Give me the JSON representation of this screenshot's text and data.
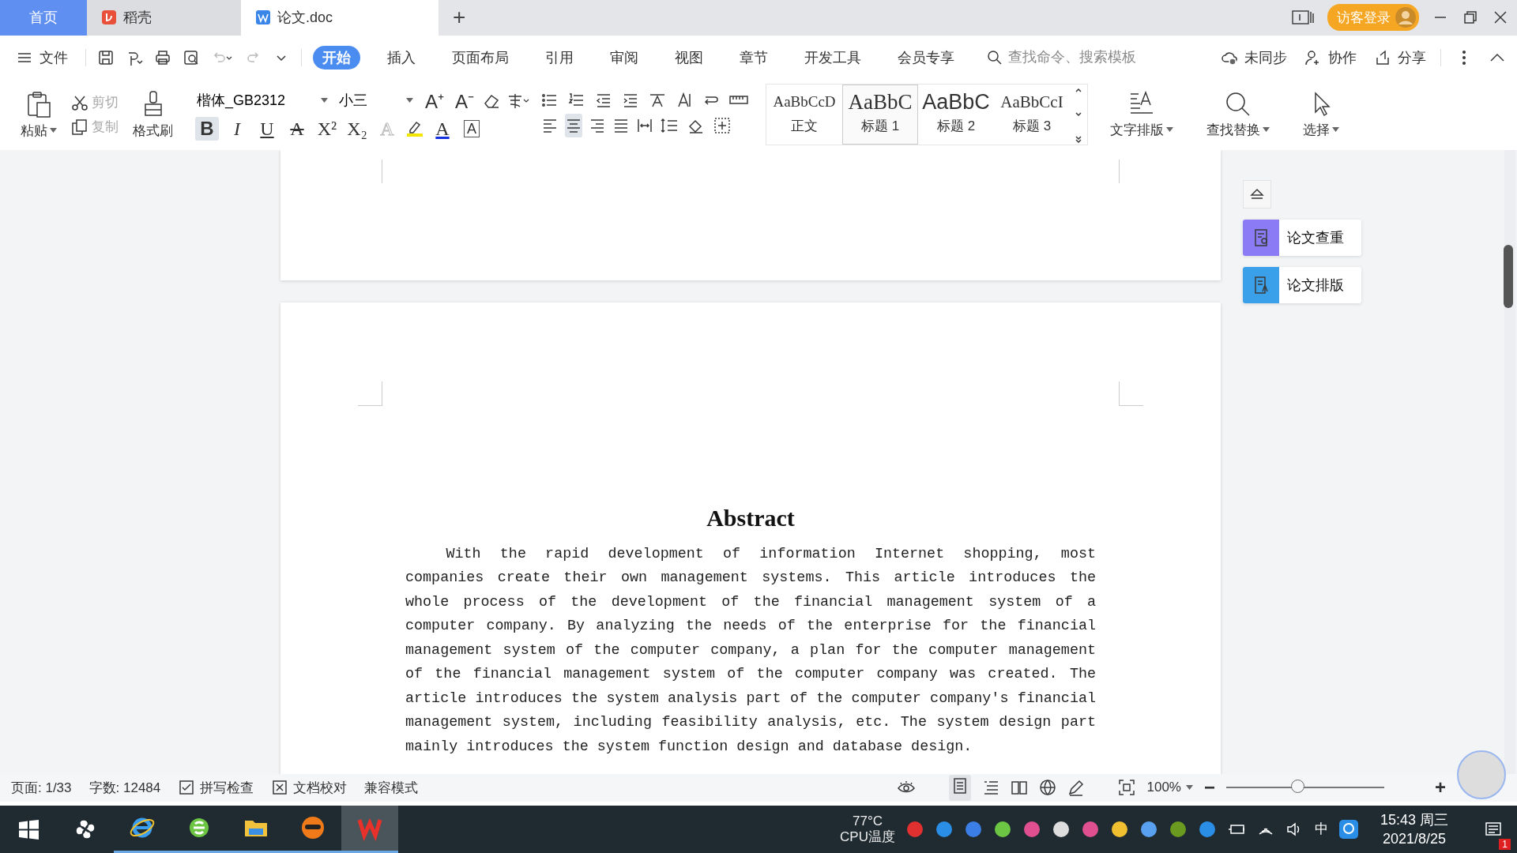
{
  "tabs": [
    {
      "label": "首页",
      "kind": "home",
      "selected": false
    },
    {
      "label": "稻壳",
      "kind": "app",
      "selected": false
    },
    {
      "label": "论文.doc",
      "kind": "doc",
      "selected": true
    }
  ],
  "new_tab": "+",
  "login_button": "访客登录",
  "menu": {
    "file": "文件",
    "tabs": [
      {
        "label": "开始",
        "selected": true
      },
      {
        "label": "插入",
        "selected": false
      },
      {
        "label": "页面布局",
        "selected": false
      },
      {
        "label": "引用",
        "selected": false
      },
      {
        "label": "审阅",
        "selected": false
      },
      {
        "label": "视图",
        "selected": false
      },
      {
        "label": "章节",
        "selected": false
      },
      {
        "label": "开发工具",
        "selected": false
      },
      {
        "label": "会员专享",
        "selected": false
      }
    ],
    "search": {
      "placeholder": "查找命令、搜索模板"
    },
    "actions": [
      {
        "label": "未同步",
        "kind": "sync"
      },
      {
        "label": "协作",
        "kind": "collab"
      },
      {
        "label": "分享",
        "kind": "share"
      }
    ]
  },
  "clipboard": {
    "paste": "粘贴",
    "cut": {
      "label": "剪切",
      "disabled": true
    },
    "copy": {
      "label": "复制",
      "disabled": true
    },
    "painter": "格式刷"
  },
  "font": {
    "name": "楷体_GB2312",
    "size": "小三"
  },
  "font_size_buttons": [
    "A⁺",
    "A⁻"
  ],
  "format_buttons": [
    {
      "glyph": "B",
      "kind": "bold",
      "selected": true
    },
    {
      "glyph": "I",
      "kind": "italic",
      "selected": false
    },
    {
      "glyph": "U",
      "kind": "underline",
      "selected": false
    },
    {
      "glyph": "A",
      "kind": "strike",
      "selected": false
    },
    {
      "glyph": "X²",
      "kind": "sup",
      "selected": false
    },
    {
      "glyph": "X₂",
      "kind": "sub",
      "selected": false
    },
    {
      "glyph": "A",
      "kind": "effect",
      "selected": false
    },
    {
      "glyph": "A",
      "kind": "color",
      "selected": false
    },
    {
      "glyph": "A",
      "kind": "border",
      "selected": false
    }
  ],
  "align_buttons": [
    {
      "kind": "left",
      "selected": false
    },
    {
      "kind": "center",
      "selected": true
    },
    {
      "kind": "right",
      "selected": false
    },
    {
      "kind": "justify",
      "selected": false
    },
    {
      "kind": "distribute",
      "selected": false
    }
  ],
  "styles": [
    {
      "sample": "AaBbCcD",
      "label": "正文",
      "kind": "body",
      "selected": false
    },
    {
      "sample": "AaBbC",
      "label": "标题 1",
      "kind": "h1",
      "selected": true
    },
    {
      "sample": "AaBbC",
      "label": "标题 2",
      "kind": "h2",
      "selected": false
    },
    {
      "sample": "AaBbCcI",
      "label": "标题 3",
      "kind": "h3",
      "selected": false
    }
  ],
  "big_buttons": [
    {
      "label": "文字排版",
      "kind": "layout"
    },
    {
      "label": "查找替换",
      "kind": "find"
    },
    {
      "label": "选择",
      "kind": "select"
    }
  ],
  "document": {
    "heading": "Abstract",
    "paragraph": "With the rapid development of information Internet shopping, most companies create their own management systems. This article introduces the whole process of the development of the financial management system of a computer company. By analyzing the needs of the enterprise for the financial management system of the computer company, a plan for the computer management of the financial management system of the computer company was created. The article introduces the system analysis part of the computer company's financial management system, including feasibility analysis, etc. The system design part mainly introduces the system function design and database design."
  },
  "side_panel": [
    {
      "label": "论文查重",
      "color": "#8b7cf6"
    },
    {
      "label": "论文排版",
      "color": "#3aa0ea"
    }
  ],
  "status_bar": {
    "page": "页面: 1/33",
    "words": "字数: 12484",
    "spell": "拼写检查",
    "proof": "文档校对",
    "mode": "兼容模式",
    "zoom": "100%",
    "zoom_slider": {
      "level": 0.45
    },
    "zoom_minus": "−",
    "zoom_plus": "+"
  },
  "taskbar": {
    "temp": "77°C",
    "temp_label": "CPU温度",
    "ime": "中",
    "time": "15:43 周三",
    "date": "2021/8/25",
    "notifications": "1"
  }
}
